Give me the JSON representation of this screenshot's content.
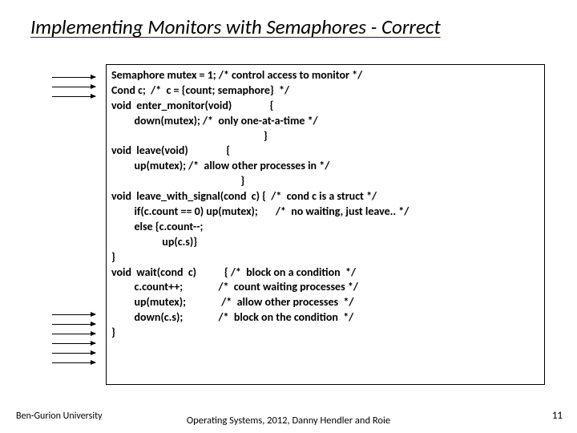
{
  "title": "Implementing Monitors with Semaphores - Correct",
  "code": {
    "l1": "Semaphore mutex = 1; /* control access to monitor */",
    "l2": "Cond c;  /*  c = {count; semaphore}  */",
    "l3": "void  enter_monitor(void)               {",
    "l4": "         down(mutex); /*  only one-at-a-time */",
    "l5": "                                                            }",
    "l6": "void  leave(void)               {",
    "l7": "         up(mutex); /*  allow other processes in */",
    "l8": "                                                   }",
    "l9": "void  leave_with_signal(cond  c) {  /*  cond c is a struct */",
    "l10": "         if(c.count == 0) up(mutex);       /*  no waiting, just leave.. */",
    "l11": "         else {c.count--;",
    "l12": "                    up(c.s)}",
    "l13": "}",
    "l14": "void  wait(cond  c)           { /*  block on a condition  */",
    "l15": "         c.count++;              /*  count waiting processes */",
    "l16": "         up(mutex);              /*  allow other processes  */",
    "l17": "         down(c.s);              /*  block on the condition  */",
    "l18": "}"
  },
  "footer": {
    "left": "Ben-Gurion University",
    "center": "Operating Systems, 2012, Danny Hendler and Roie",
    "right": "11"
  }
}
